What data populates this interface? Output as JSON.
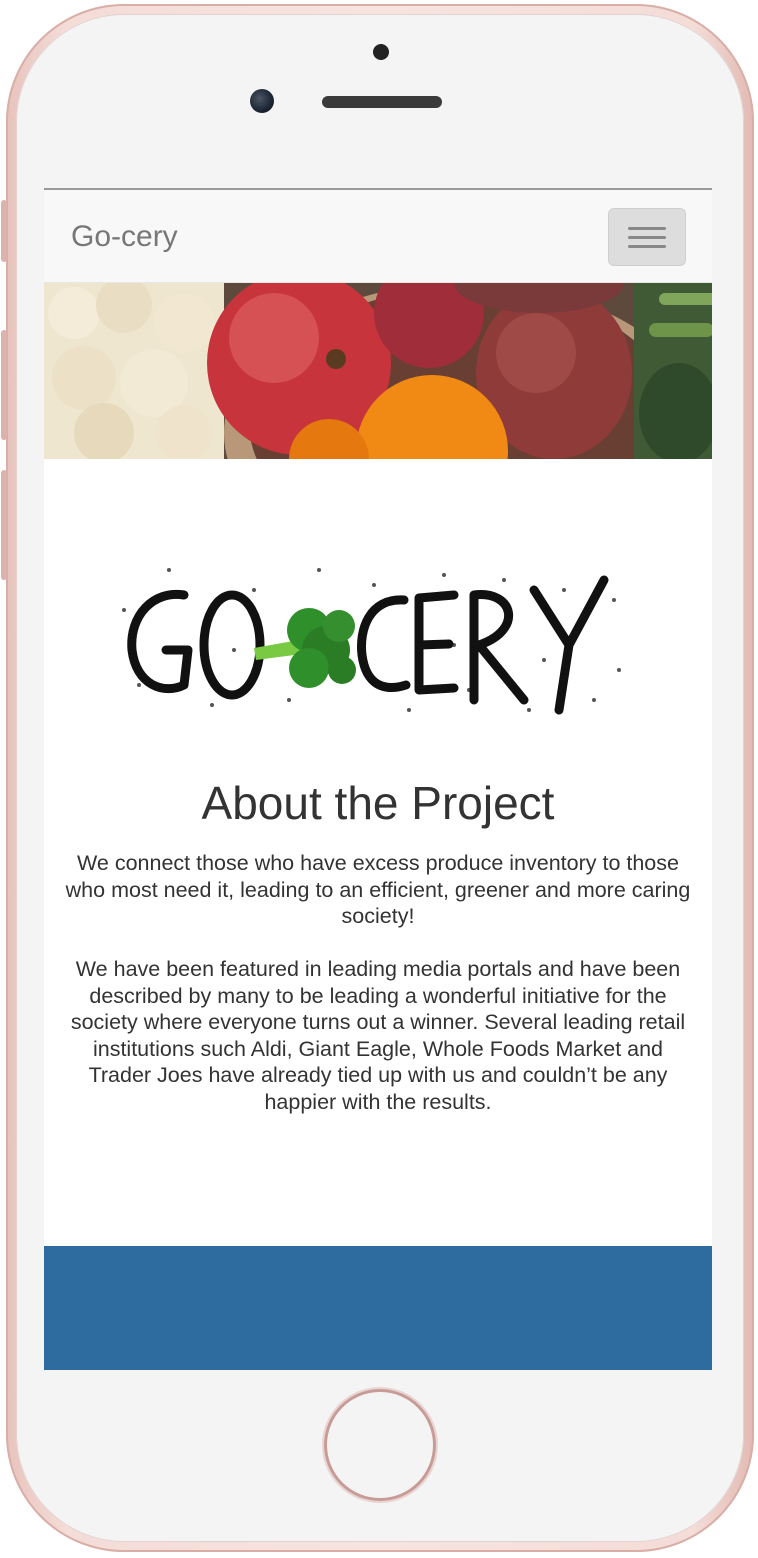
{
  "navbar": {
    "brand": "Go-cery",
    "menu_icon": "hamburger-menu-icon"
  },
  "hero": {
    "image": "fresh-produce-photo"
  },
  "logo": {
    "text": "GO-CERY",
    "icon": "broccoli-icon"
  },
  "about": {
    "title": "About the Project",
    "paragraph1": "We connect those who have excess produce inventory to those who most need it, leading to an efficient, greener and more caring society!",
    "paragraph2": "We have been featured in leading media portals and have been described by many to be leading a wonderful initiative for the society where everyone turns out a winner. Several leading retail institutions such Aldi, Giant Eagle, Whole Foods Market and Trader Joes have already tied up with us and couldn’t be any happier with the results."
  },
  "colors": {
    "navbar_bg": "#f8f8f8",
    "brand_text": "#777777",
    "footer_band": "#2e6b9e",
    "phone_frame": "#f4dcd7",
    "broccoli": "#2f8f2a"
  }
}
